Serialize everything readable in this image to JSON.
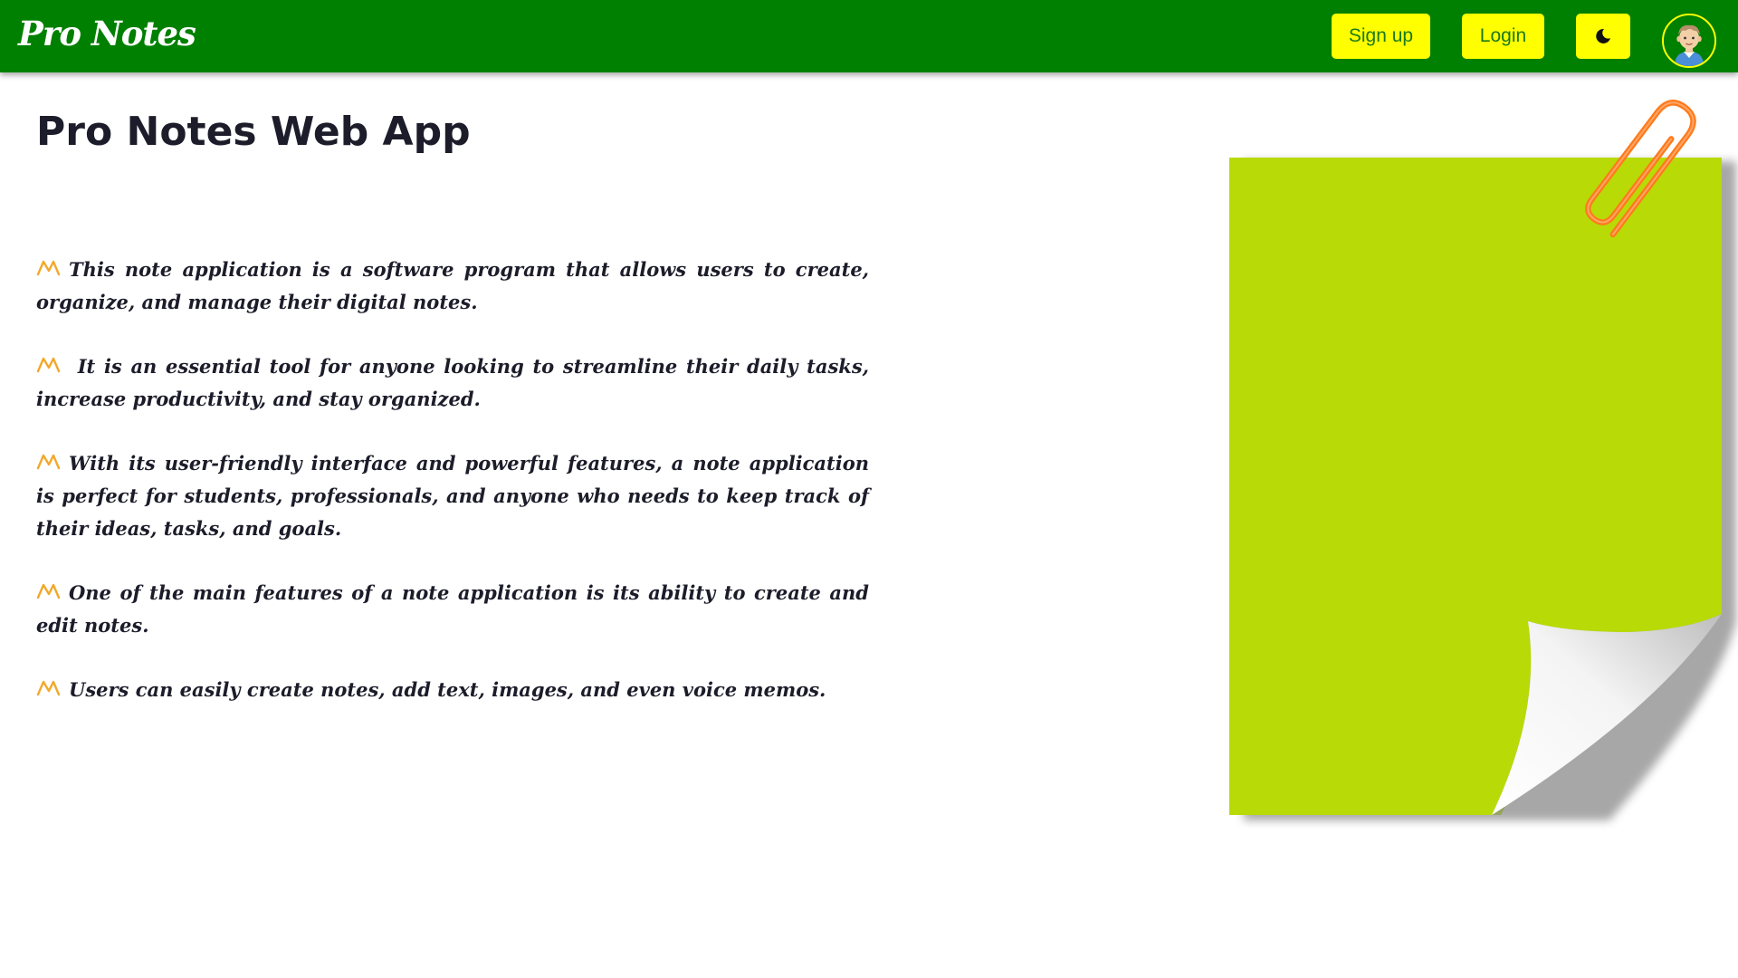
{
  "navbar": {
    "brand": "Pro Notes",
    "signup_label": "Sign up",
    "login_label": "Login",
    "theme_icon": "moon-icon",
    "avatar_icon": "user-avatar-icon"
  },
  "main": {
    "title": "Pro Notes Web App",
    "bullet_icon": "pen-zigzag-icon",
    "paragraphs": [
      "This note application is a software program that allows users to create, organize, and manage their digital notes.",
      " It is an essential tool for anyone looking to streamline their daily tasks, increase productivity, and stay organized.",
      "With its user-friendly interface and powerful features, a note application is perfect for students, professionals, and anyone who needs to keep track of their ideas, tasks, and goals.",
      "One of the main features of a note application is its ability to create and edit notes.",
      "Users can easily create notes, add text, images, and even voice memos."
    ]
  },
  "illustration": {
    "note_color": "#b8da07",
    "clip_color": "#ff7a1a",
    "icons": [
      "sticky-note-icon",
      "paperclip-icon"
    ]
  },
  "colors": {
    "navbar_bg": "#008000",
    "button_bg": "#ffff00",
    "button_text": "#1a7a1a",
    "text": "#1c1c2a",
    "bullet": "#f2a82a"
  }
}
